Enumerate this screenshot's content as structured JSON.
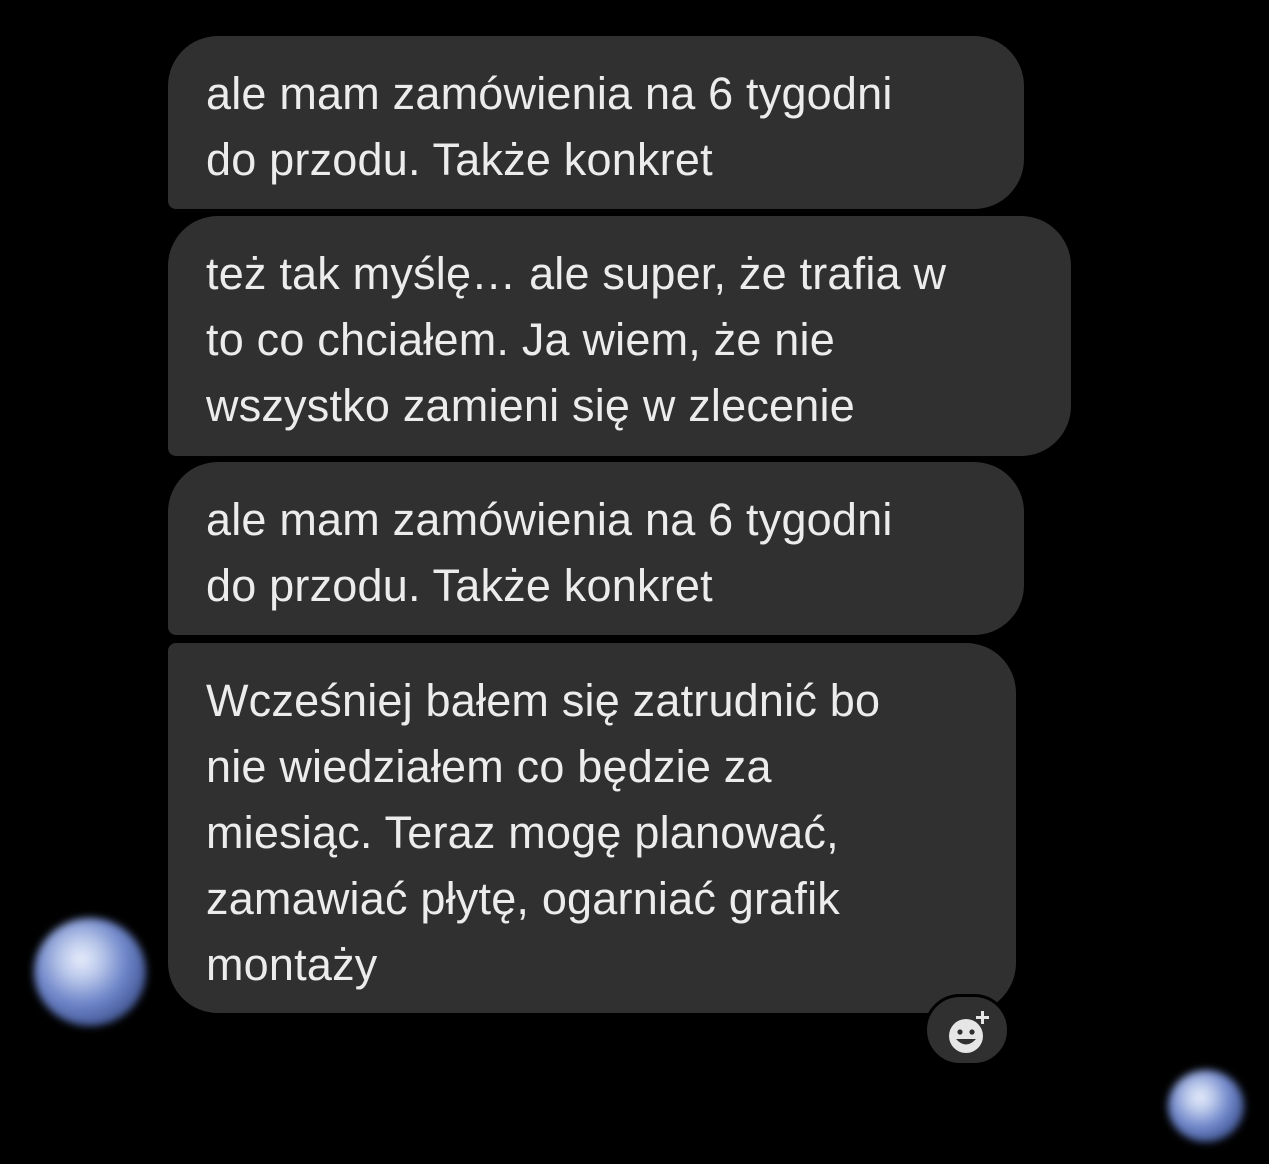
{
  "messages": [
    {
      "text": "ale mam zamówienia na 6 tygodni\ndo przodu. Także konkret"
    },
    {
      "text": "też tak myślę… ale super, że trafia w\nto co chciałem. Ja wiem, że nie\nwszystko zamieni się w zlecenie"
    },
    {
      "text": "ale mam zamówienia na 6 tygodni\ndo przodu. Także konkret"
    },
    {
      "text": "Wcześniej bałem się zatrudnić bo\nnie wiedziałem co będzie za\nmiesiąc. Teraz mogę planować,\nzamawiać płytę, ogarniać grafik\nmontaży"
    }
  ],
  "icons": {
    "reaction": "add-reaction-icon",
    "avatar_sender": "avatar",
    "avatar_seen": "read-receipt-avatar"
  },
  "colors": {
    "background": "#000000",
    "bubble": "#303030",
    "text": "#ececec"
  }
}
